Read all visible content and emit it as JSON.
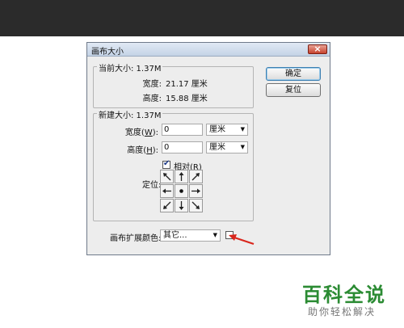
{
  "dialog": {
    "title": "画布大小",
    "close_label": "×",
    "buttons": {
      "ok": "确定",
      "reset": "复位"
    },
    "current_size": {
      "legend": "当前大小: 1.37M",
      "width_label": "宽度:",
      "width_value": "21.17 厘米",
      "height_label": "高度:",
      "height_value": "15.88 厘米"
    },
    "new_size": {
      "legend": "新建大小: 1.37M",
      "width_label_pre": "宽度(",
      "width_key": "W",
      "width_label_post": "):",
      "width_value": "0",
      "width_unit": "厘米",
      "height_label_pre": "高度(",
      "height_key": "H",
      "height_label_post": "):",
      "height_value": "0",
      "height_unit": "厘米",
      "relative_pre": "相对(",
      "relative_key": "R",
      "relative_post": ")",
      "relative_checked": true,
      "anchor_label": "定位:"
    },
    "canvas_extension": {
      "label": "画布扩展颜色:",
      "value": "其它..."
    }
  },
  "watermark": {
    "brand": "百科全说",
    "tagline": "助你轻松解决"
  },
  "colors": {
    "top_bar": "#2b2b2b",
    "dialog_bg": "#ededed",
    "brand_green": "#2b8b33",
    "annotation_red": "#d9261c"
  }
}
